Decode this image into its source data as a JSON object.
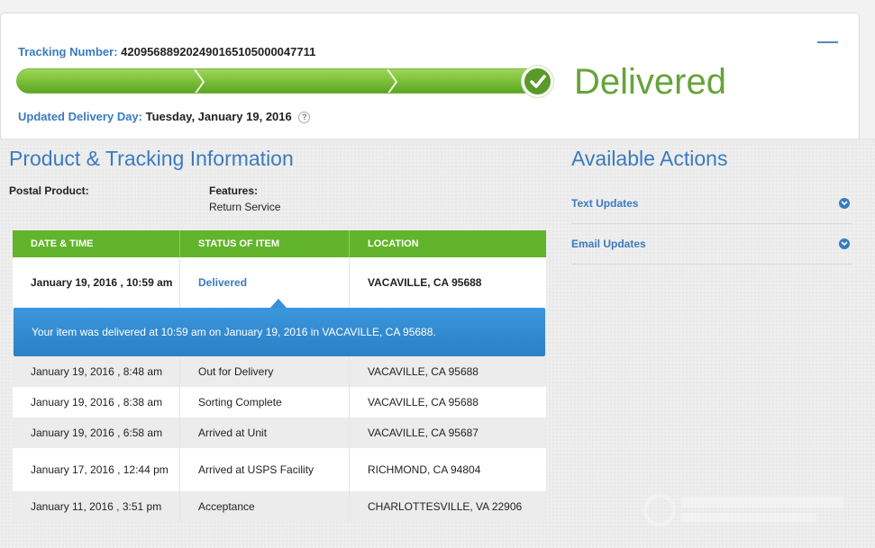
{
  "header": {
    "tracking_label": "Tracking Number:",
    "tracking_number": "420956889202490165105000047711",
    "status": "Delivered",
    "updated_label": "Updated Delivery Day:",
    "updated_value": "Tuesday, January 19, 2016",
    "help_icon": "?"
  },
  "colors": {
    "brand_blue": "#3a7bbf",
    "progress_green": "#7cc03a",
    "delivered_green": "#66a33a",
    "table_header_green": "#62b42c",
    "highlight_blue": "#2f88cf"
  },
  "product": {
    "title": "Product & Tracking Information",
    "postal_label": "Postal Product:",
    "features_label": "Features:",
    "features_value": "Return Service"
  },
  "table": {
    "headers": [
      "DATE & TIME",
      "STATUS OF ITEM",
      "LOCATION"
    ],
    "first_row": {
      "date": "January 19, 2016 , 10:59 am",
      "status": "Delivered",
      "location": "VACAVILLE, CA 95688"
    },
    "message": "Your item was delivered at 10:59 am on January 19, 2016 in VACAVILLE, CA 95688.",
    "rows": [
      {
        "date": "January 19, 2016 , 8:48 am",
        "status": "Out for Delivery",
        "location": "VACAVILLE, CA 95688"
      },
      {
        "date": "January 19, 2016 , 8:38 am",
        "status": "Sorting Complete",
        "location": "VACAVILLE, CA 95688"
      },
      {
        "date": "January 19, 2016 , 6:58 am",
        "status": "Arrived at Unit",
        "location": "VACAVILLE, CA 95687"
      },
      {
        "date": "January 17, 2016 , 12:44 pm",
        "status": "Arrived at USPS Facility",
        "location": "RICHMOND, CA 94804"
      },
      {
        "date": "January 11, 2016 , 3:51 pm",
        "status": "Acceptance",
        "location": "CHARLOTTESVILLE, VA 22906"
      }
    ]
  },
  "actions": {
    "title": "Available Actions",
    "items": [
      {
        "label": "Text Updates",
        "icon": "chevron-down-icon"
      },
      {
        "label": "Email Updates",
        "icon": "chevron-down-icon"
      }
    ]
  }
}
